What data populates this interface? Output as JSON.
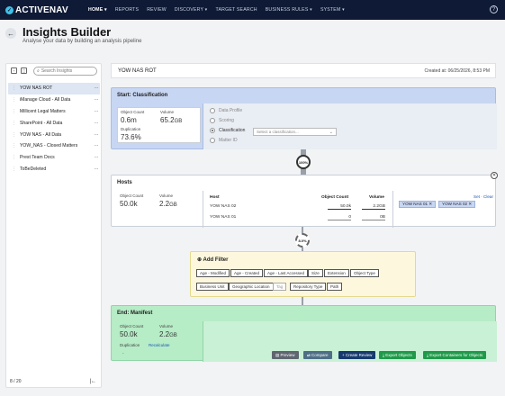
{
  "app": {
    "logo_text": "ACTIVENAV",
    "nav": [
      {
        "label": "HOME ▾"
      },
      {
        "label": "REPORTS"
      },
      {
        "label": "REVIEW"
      },
      {
        "label": "DISCOVERY ▾"
      },
      {
        "label": "TARGET SEARCH"
      },
      {
        "label": "BUSINESS RULES ▾"
      },
      {
        "label": "SYSTEM ▾"
      }
    ],
    "help_icon": "?"
  },
  "page": {
    "title": "Insights Builder",
    "subtitle": "Analyse your data by building an analysis pipeline"
  },
  "sidebar": {
    "search_placeholder": "Search Insights",
    "items": [
      {
        "label": "YOW NAS ROT"
      },
      {
        "label": "iManage Cloud - All Data"
      },
      {
        "label": "Millicent Legal Matters"
      },
      {
        "label": "SharePoint - All Data"
      },
      {
        "label": "YOW NAS - All Data"
      },
      {
        "label": "YOW_NAS - Closed Matters"
      },
      {
        "label": "Prest Team Docs"
      },
      {
        "label": "ToBeDeleted"
      }
    ],
    "more_glyph": "···",
    "drag_glyph": "⋮",
    "pagination": "8 / 20",
    "collapse_glyph": "|←"
  },
  "insight": {
    "name": "YOW NAS ROT",
    "created": "Created at: 06/25/2026, 8:53 PM"
  },
  "start": {
    "title": "Start: Classification",
    "object_count_label": "Object Count",
    "object_count": "0.6m",
    "volume_label": "Volume",
    "volume": "65.2",
    "volume_unit": "GB",
    "duplication_label": "Duplication",
    "duplication": "73.6%",
    "options": [
      {
        "label": "Data Profile",
        "selected": false
      },
      {
        "label": "Scoring",
        "selected": false
      },
      {
        "label": "Classification",
        "selected": true
      },
      {
        "label": "Matter ID",
        "selected": false
      }
    ],
    "select_placeholder": "Select a classification..."
  },
  "gauge1": "100%",
  "hosts": {
    "title": "Hosts",
    "object_count_label": "Object Count",
    "object_count": "50.0k",
    "volume_label": "Volume",
    "volume": "2.2",
    "volume_unit": "GB",
    "columns": {
      "host": "Host",
      "count": "Object Count",
      "volume": "Volume"
    },
    "rows": [
      {
        "host": "YOW NAS 02",
        "count": "50.0k",
        "volume": "2.2GB"
      },
      {
        "host": "YOW NAS 01",
        "count": "0",
        "volume": "0B"
      }
    ],
    "set_label": "Set",
    "clear_label": "Clear",
    "chips": [
      "YOW NAS 01 ✕",
      "YOW NAS 02 ✕"
    ],
    "close_glyph": "✕"
  },
  "gauge2": "8.0%",
  "filter": {
    "title": "Add Filter",
    "buttons_row1": [
      "Age - Modified",
      "Age - Created",
      "Age - Last Accessed",
      "Size",
      "Extension",
      "Object Type"
    ],
    "buttons_row2": [
      "Business Unit",
      "Geographic Location",
      "Tag",
      "Repository Type",
      "Path"
    ]
  },
  "end": {
    "title": "End: Manifest",
    "object_count_label": "Object Count",
    "object_count": "50.0k",
    "volume_label": "Volume",
    "volume": "2.2",
    "volume_unit": "GB",
    "duplication_label": "Duplication",
    "recalculate": "Recalculate",
    "duplication_value": "-",
    "actions": [
      {
        "label": "Preview",
        "color": "#5f6670"
      },
      {
        "label": "Compare",
        "color": "#4f6f86"
      },
      {
        "label": "+ Create Review",
        "color": "#173a6e"
      },
      {
        "label": "Export Objects",
        "color": "#1f9a4a"
      },
      {
        "label": "Export Containers for Objects",
        "color": "#1f9a4a"
      }
    ]
  }
}
